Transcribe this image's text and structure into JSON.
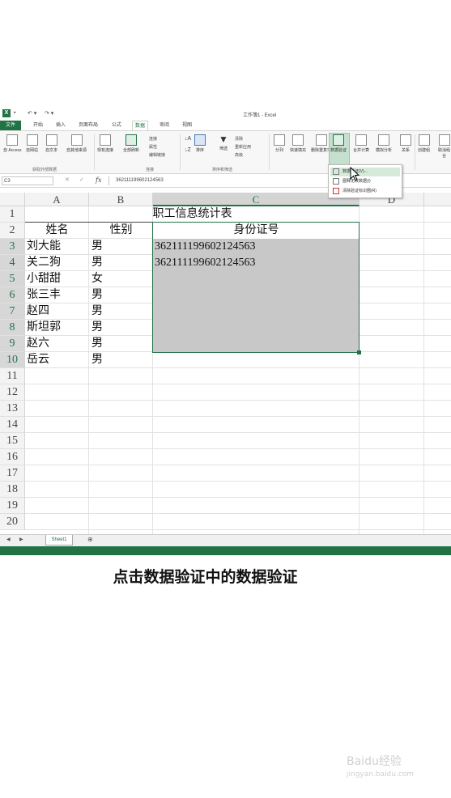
{
  "window": {
    "title": "工作簿1 - Excel"
  },
  "tabs": [
    {
      "label": "文件",
      "file": true
    },
    {
      "label": "开始"
    },
    {
      "label": "插入"
    },
    {
      "label": "页面布局"
    },
    {
      "label": "公式"
    },
    {
      "label": "数据",
      "active": true
    },
    {
      "label": "审阅"
    },
    {
      "label": "视图"
    }
  ],
  "ribbon": {
    "access": "自 Access",
    "web": "自网站",
    "text": "自文本",
    "other": "自其他来源",
    "existing": "现有连接",
    "refresh": "全部刷新",
    "connections": "连接",
    "properties": "属性",
    "edit_links": "编辑链接",
    "sort": "排序",
    "filter": "筛选",
    "clear": "清除",
    "reapply": "重新应用",
    "advanced": "高级",
    "split": "分列",
    "flash_fill": "快速填充",
    "remove_dup": "删除重复项",
    "data_validation": "数据验证",
    "consolidate": "合并计算",
    "whatif": "模拟分析",
    "relations": "关系",
    "group": "创建组",
    "ungroup": "取消组合",
    "group_get_external": "获取外部数据",
    "group_connections": "连接",
    "group_sort_filter": "排序和筛选"
  },
  "dropdown": {
    "items": [
      {
        "label": "数据验证(V)...",
        "highlighted": true
      },
      {
        "label": "圈释无效数据(I)"
      },
      {
        "label": "清除验证标识圈(R)"
      }
    ]
  },
  "formula_bar": {
    "name_box": "C3",
    "fx": "fx",
    "value": "362111199602124563"
  },
  "columns": [
    {
      "label": "A",
      "selected": false
    },
    {
      "label": "B",
      "selected": false
    },
    {
      "label": "C",
      "selected": true
    },
    {
      "label": "D",
      "selected": false
    }
  ],
  "rows": [
    "1",
    "2",
    "3",
    "4",
    "5",
    "6",
    "7",
    "8",
    "9",
    "10",
    "11",
    "12",
    "13",
    "14",
    "15",
    "16",
    "17",
    "18",
    "19",
    "20"
  ],
  "sheet": {
    "title": "职工信息统计表",
    "headers": {
      "name": "姓名",
      "gender": "性别",
      "id": "身份证号"
    },
    "data": [
      {
        "name": "刘大能",
        "gender": "男",
        "id": "362111199602124563"
      },
      {
        "name": "关二狗",
        "gender": "男",
        "id": "362111199602124563"
      },
      {
        "name": "小甜甜",
        "gender": "女",
        "id": ""
      },
      {
        "name": "张三丰",
        "gender": "男",
        "id": ""
      },
      {
        "name": "赵四",
        "gender": "男",
        "id": ""
      },
      {
        "name": "斯坦郭",
        "gender": "男",
        "id": ""
      },
      {
        "name": "赵六",
        "gender": "男",
        "id": ""
      },
      {
        "name": "岳云",
        "gender": "男",
        "id": ""
      }
    ]
  },
  "sheet_tab": "Sheet1",
  "caption": "点击数据验证中的数据验证",
  "watermark": {
    "brand": "Baidu经验",
    "url": "jingyan.baidu.com"
  },
  "colors": {
    "excel_green": "#217346",
    "selection": "#c8c8c8"
  }
}
